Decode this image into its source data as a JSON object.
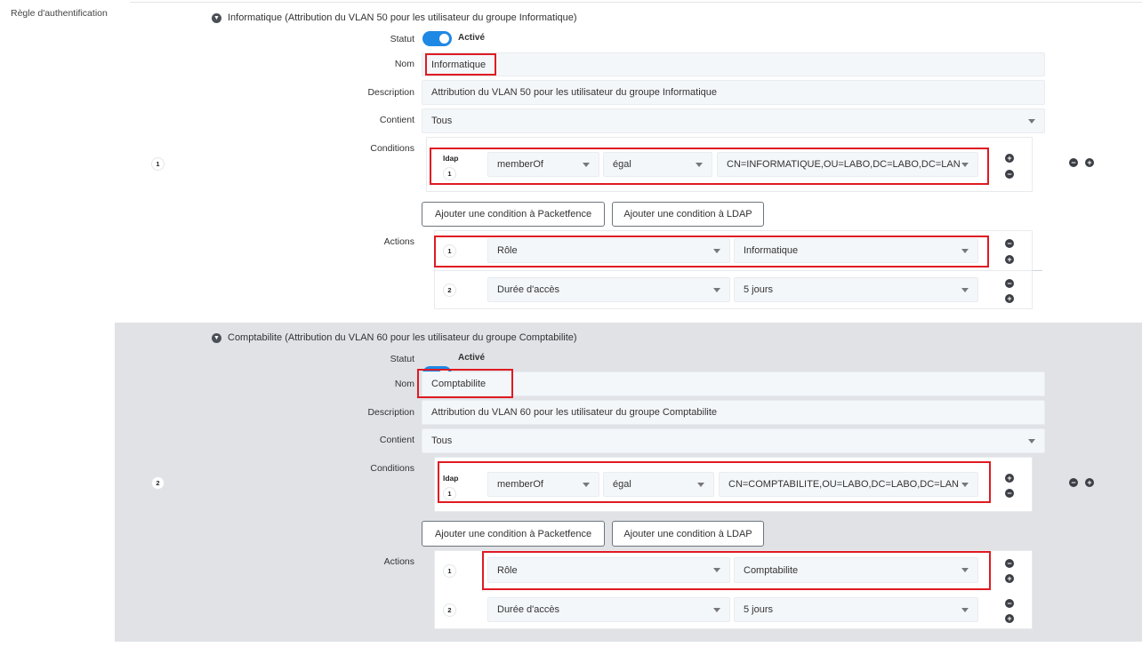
{
  "page": {
    "label": "Règle d'authentification"
  },
  "common": {
    "labels": {
      "status": "Statut",
      "name": "Nom",
      "description": "Description",
      "contains": "Contient",
      "conditions": "Conditions",
      "actions": "Actions"
    },
    "status_value": "Activé",
    "add_packetfence": "Ajouter une condition à Packetfence",
    "add_ldap": "Ajouter une condition à LDAP",
    "ldap_tag": "ldap",
    "minus": "−",
    "plus": "+"
  },
  "rules": [
    {
      "index": "1",
      "header": "Informatique (Attribution du VLAN 50 pour les utilisateur du groupe Informatique)",
      "name": "Informatique",
      "description": "Attribution du VLAN 50 pour les utilisateur du groupe Informatique",
      "contains": "Tous",
      "condition": {
        "index": "1",
        "attribute": "memberOf",
        "operator": "égal",
        "value": "CN=INFORMATIQUE,OU=LABO,DC=LABO,DC=LAN"
      },
      "actions": [
        {
          "index": "1",
          "type": "Rôle",
          "value": "Informatique"
        },
        {
          "index": "2",
          "type": "Durée d'accès",
          "value": "5 jours"
        }
      ]
    },
    {
      "index": "2",
      "header": "Comptabilite (Attribution du VLAN 60 pour les utilisateur du groupe Comptabilite)",
      "name": "Comptabilite",
      "description": "Attribution du VLAN 60 pour les utilisateur du groupe Comptabilite",
      "contains": "Tous",
      "condition": {
        "index": "1",
        "attribute": "memberOf",
        "operator": "égal",
        "value": "CN=COMPTABILITE,OU=LABO,DC=LABO,DC=LAN"
      },
      "actions": [
        {
          "index": "1",
          "type": "Rôle",
          "value": "Comptabilite"
        },
        {
          "index": "2",
          "type": "Durée d'accès",
          "value": "5 jours"
        }
      ]
    }
  ],
  "colors": {
    "accent": "#1e88e5",
    "highlight": "#e01a22",
    "rule_bg": "#e0e2e6"
  }
}
